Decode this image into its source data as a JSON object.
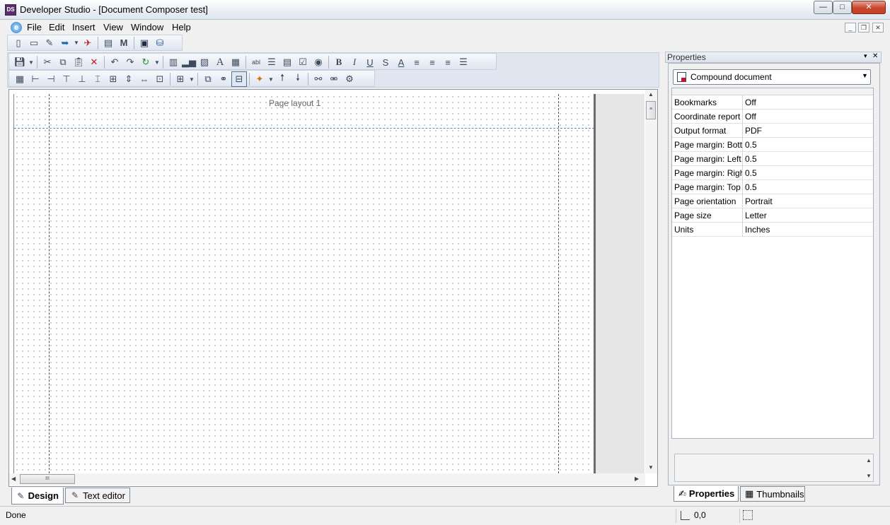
{
  "window": {
    "title": "Developer Studio - [Document Composer test]",
    "app_icon": "DS",
    "minimize": "—",
    "maximize": "□",
    "close": "✕"
  },
  "menu": {
    "items": [
      "File",
      "Edit",
      "Insert",
      "View",
      "Window",
      "Help"
    ],
    "mdi_minimize": "_",
    "mdi_restore": "❐",
    "mdi_close": "✕"
  },
  "toolbar": {
    "standard_icons": [
      "new-icon",
      "open-icon",
      "edit-icon",
      "run-icon",
      "dropdown-icon",
      "deploy-icon",
      "properties-icon",
      "mdi-icon",
      "terminal-icon",
      "database-icon"
    ],
    "format_icons_row1": [
      "save-icon",
      "cut-icon",
      "copy-icon",
      "paste-icon",
      "delete-icon",
      "undo-icon",
      "redo-icon",
      "refresh-icon",
      "report-icon",
      "chart-icon",
      "image-icon",
      "text-icon",
      "grid-icon",
      "textbox-icon",
      "list-icon",
      "combo-icon",
      "checkbox-icon",
      "radio-icon",
      "bold-icon",
      "italic-icon",
      "underline-icon",
      "strikethrough-icon",
      "font-color-icon",
      "align-left-icon",
      "align-center-icon",
      "align-right-icon",
      "justify-icon"
    ],
    "format_icons_row2": [
      "show-grid-icon",
      "align-lefts-icon",
      "align-rights-icon",
      "align-tops-icon",
      "align-bottoms-icon",
      "center-vertical-icon",
      "center-horizontal-icon",
      "same-height-icon",
      "same-width-icon",
      "same-size-icon",
      "table-icon",
      "link-icon",
      "connect-icon",
      "layout-icon",
      "new-section-icon",
      "move-up-icon",
      "move-down-icon",
      "group-icon",
      "ungroup-icon",
      "breakdown-icon"
    ]
  },
  "design": {
    "page_label": "Page layout 1",
    "thumb_grip": "≡",
    "hthumb_grip": "III"
  },
  "tabs": {
    "design": "Design",
    "text_editor": "Text editor"
  },
  "properties": {
    "header": "Properties",
    "object": "Compound document",
    "rows": [
      {
        "name": "Bookmarks",
        "value": "Off"
      },
      {
        "name": "Coordinate report",
        "value": "Off"
      },
      {
        "name": "Output format",
        "value": "PDF"
      },
      {
        "name": "Page margin: Bottom",
        "value": "0.5"
      },
      {
        "name": "Page margin: Left",
        "value": "0.5"
      },
      {
        "name": "Page margin: Right",
        "value": "0.5"
      },
      {
        "name": "Page margin: Top",
        "value": "0.5"
      },
      {
        "name": "Page orientation",
        "value": "Portrait"
      },
      {
        "name": "Page size",
        "value": "Letter"
      },
      {
        "name": "Units",
        "value": "Inches"
      }
    ],
    "tab_properties": "Properties",
    "tab_thumbnails": "Thumbnails"
  },
  "status": {
    "text": "Done",
    "coords": "0,0"
  }
}
